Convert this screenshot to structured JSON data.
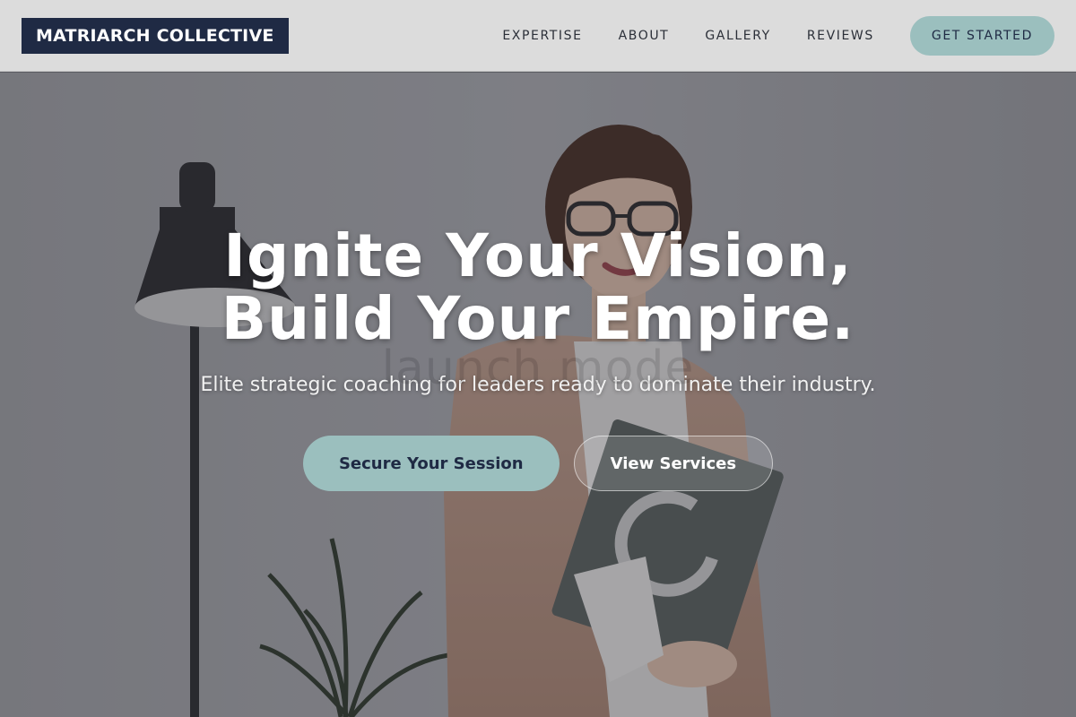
{
  "brand": {
    "name": "MATRIARCH COLLECTIVE"
  },
  "nav": {
    "links": [
      "EXPERTISE",
      "ABOUT",
      "GALLERY",
      "REVIEWS"
    ],
    "cta_label": "GET STARTED"
  },
  "hero": {
    "headline_line1": "Ignite Your Vision,",
    "headline_line2": "Build Your Empire.",
    "subheadline": "Elite strategic coaching for leaders ready to dominate their industry.",
    "watermark_text": "launch mode",
    "primary_button": "Secure Your Session",
    "secondary_button": "View Services"
  },
  "colors": {
    "logo_bg": "#1f2a44",
    "accent": "#9bbfbe",
    "header_bg": "#dcdcdc"
  }
}
